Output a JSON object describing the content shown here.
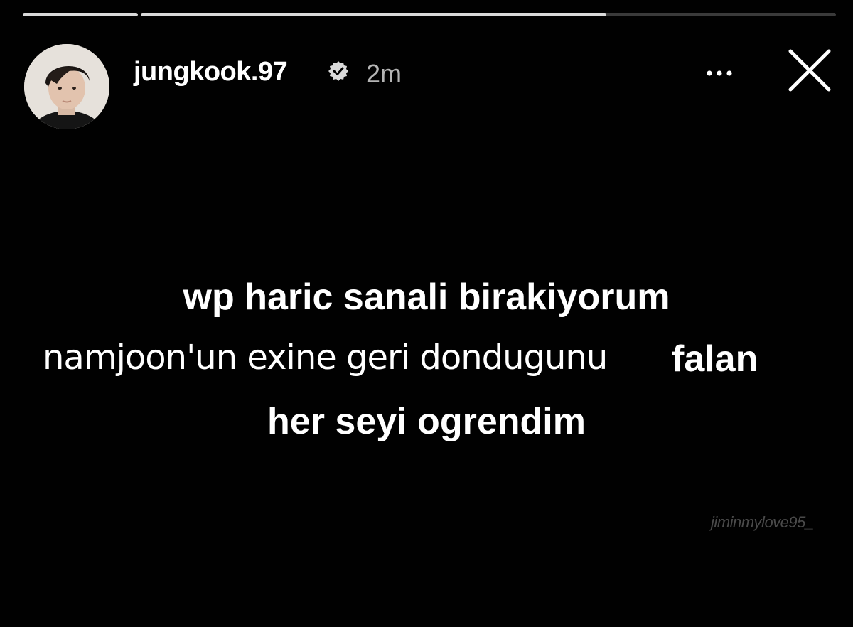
{
  "story": {
    "progress": [
      {
        "fill_percent": 100
      },
      {
        "fill_percent": 67
      }
    ],
    "header": {
      "username": "jungkook.97",
      "time": "2m",
      "more_icon": "more-horizontal-icon",
      "close_icon": "close-icon",
      "verified_icon": "verified-badge-icon"
    },
    "content": {
      "line1": "wp haric sanali birakiyorum",
      "line2": "namjoon'un exine geri dondugunu",
      "line2_bold": "falan",
      "line3": "her seyi ogrendim"
    },
    "watermark": "jiminmylove95_"
  },
  "colors": {
    "background": "#000000",
    "text": "#ffffff",
    "time_text": "#b5b5b5",
    "progress_track": "#3a3a3a",
    "progress_fill": "#d9d9d9"
  }
}
